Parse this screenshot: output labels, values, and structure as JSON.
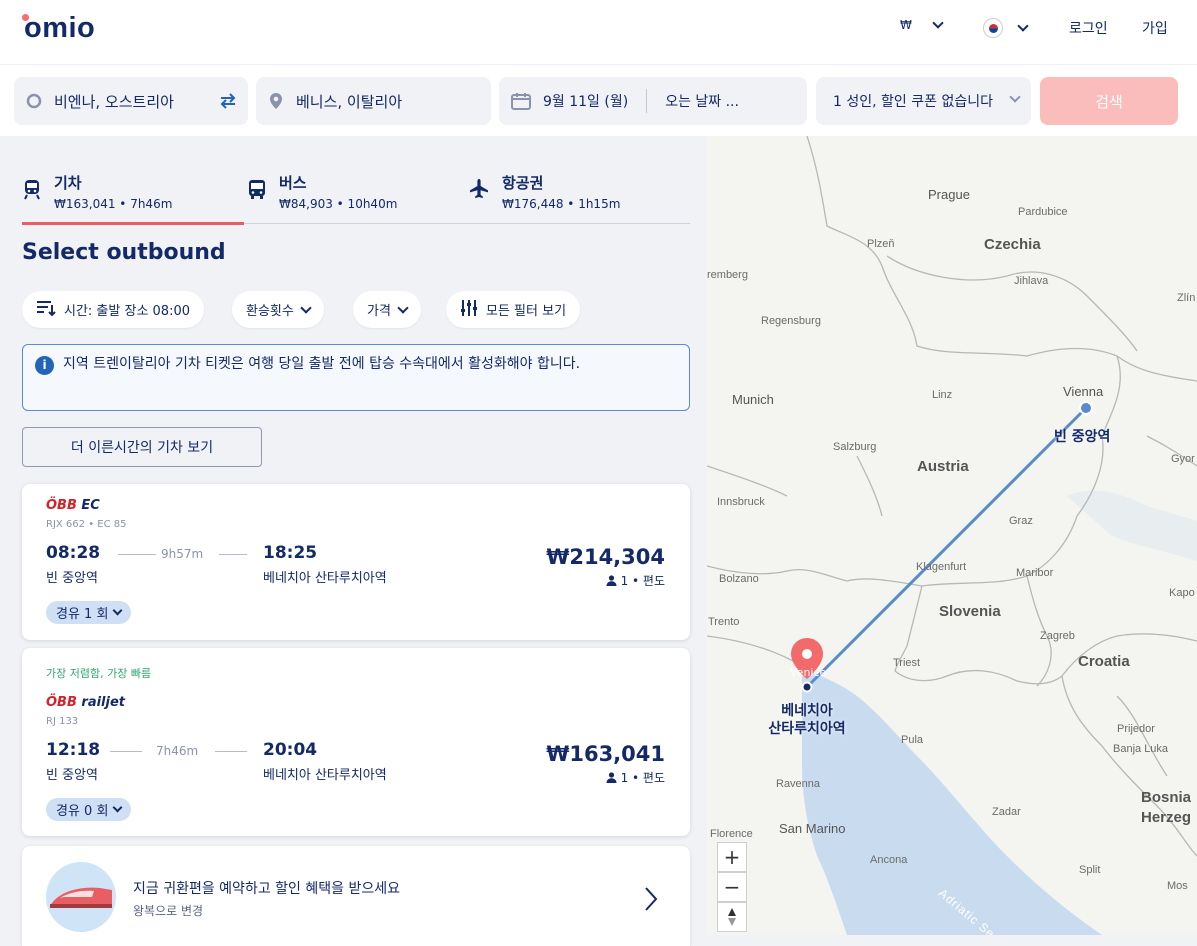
{
  "header": {
    "logo": "omio",
    "currency": "₩",
    "login": "로그인",
    "signup": "가입"
  },
  "search": {
    "origin": "비엔나, 오스트리아",
    "destination": "베니스, 이탈리아",
    "depart_date": "9월 11일 (월)",
    "return_date": "오는 날짜 ...",
    "passengers": "1 성인, 할인 쿠폰 없습니다",
    "search_button": "검색"
  },
  "tabs": [
    {
      "label": "기차",
      "summary": "₩163,041 • 7h46m"
    },
    {
      "label": "버스",
      "summary": "₩84,903 • 10h40m"
    },
    {
      "label": "항공권",
      "summary": "₩176,448 • 1h15m"
    }
  ],
  "page_title": "Select outbound",
  "filters": {
    "time": "시간: 출발 장소 08:00",
    "transfers": "환승횟수",
    "price": "가격",
    "all_filters": "모든 필터 보기"
  },
  "info_text": "지역 트렌이탈리아 기차 티켓은 여행 당일 출발 전에 탑승 수속대에서 활성화해야 합니다.",
  "earlier_button": "더 이른시간의 기차 보기",
  "results": [
    {
      "operator_prefix": "ÖBB",
      "operator_brand": "EC",
      "codes": "RJX 662 • EC 85",
      "tag": "",
      "depart_time": "08:28",
      "duration": "9h57m",
      "arrive_time": "18:25",
      "depart_station": "빈 중앙역",
      "arrive_station": "베네치아 산타루치아역",
      "price": "₩214,304",
      "passengers": "1 • 편도",
      "stops": "경유 1 회"
    },
    {
      "operator_prefix": "ÖBB",
      "operator_brand": "railjet",
      "codes": "RJ 133",
      "tag": "가장 저렴함, 가장 빠름",
      "depart_time": "12:18",
      "duration": "7h46m",
      "arrive_time": "20:04",
      "depart_station": "빈 중앙역",
      "arrive_station": "베네치아 산타루치아역",
      "price": "₩163,041",
      "passengers": "1 • 편도",
      "stops": "경유 0 회"
    }
  ],
  "promo": {
    "title": "지금 귀환편을 예약하고 할인 혜택을 받으세요",
    "subtitle": "왕복으로 변경"
  },
  "map": {
    "labels": [
      "Prague",
      "Pardubice",
      "Plzeň",
      "Czechia",
      "Jihlava",
      "Zlín",
      "Regensburg",
      "remberg",
      "Linz",
      "Munich",
      "Vienna",
      "Salzburg",
      "Austria",
      "Gyor",
      "Innsbruck",
      "Graz",
      "Klagenfurt",
      "Maribor",
      "Bolzano",
      "Slovenia",
      "Kapo",
      "Zagreb",
      "Trento",
      "Croatia",
      "Triest",
      "Pula",
      "Prijedor",
      "Banja Luka",
      "Ravenna",
      "Bosnia",
      "Herzeg",
      "Zadar",
      "Florence",
      "San Marino",
      "Ancona",
      "Split",
      "Mos",
      "Adriatic Sea"
    ],
    "origin_station": "빈 중앙역",
    "dest_station_line1": "베네치아",
    "dest_station_line2": "산타루치아역",
    "dest_city": "Venice",
    "zoom_in": "+",
    "zoom_out": "−"
  },
  "colors": {
    "brand_navy": "#132968",
    "accent_red": "#e85f63",
    "search_button": "#fbbdbb",
    "route_line": "#5a8ad0",
    "success_green": "#2fa870"
  }
}
